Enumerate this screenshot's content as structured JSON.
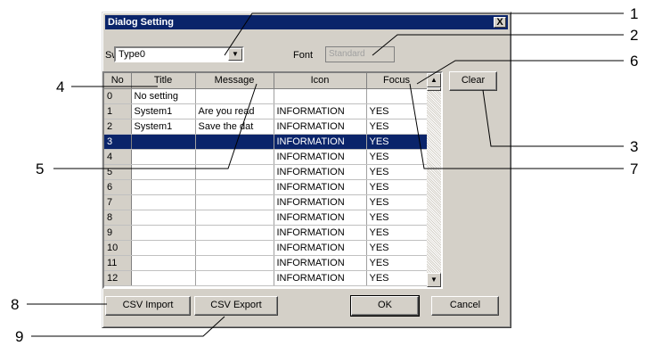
{
  "dialog": {
    "title": "Dialog Setting",
    "close_label": "X",
    "switch_label": "Switch",
    "switch_value": "Type0",
    "font_label": "Font",
    "font_value": "Standard"
  },
  "table": {
    "headers": [
      "No",
      "Title",
      "Message",
      "Icon",
      "Focus"
    ],
    "rows": [
      [
        "0",
        "No setting",
        "",
        "",
        ""
      ],
      [
        "1",
        "System1",
        "Are you read",
        "INFORMATION",
        "YES"
      ],
      [
        "2",
        "System1",
        "Save the dat",
        "INFORMATION",
        "YES"
      ],
      [
        "3",
        "",
        "",
        "INFORMATION",
        "YES"
      ],
      [
        "4",
        "",
        "",
        "INFORMATION",
        "YES"
      ],
      [
        "5",
        "",
        "",
        "INFORMATION",
        "YES"
      ],
      [
        "6",
        "",
        "",
        "INFORMATION",
        "YES"
      ],
      [
        "7",
        "",
        "",
        "INFORMATION",
        "YES"
      ],
      [
        "8",
        "",
        "",
        "INFORMATION",
        "YES"
      ],
      [
        "9",
        "",
        "",
        "INFORMATION",
        "YES"
      ],
      [
        "10",
        "",
        "",
        "INFORMATION",
        "YES"
      ],
      [
        "11",
        "",
        "",
        "INFORMATION",
        "YES"
      ],
      [
        "12",
        "",
        "",
        "INFORMATION",
        "YES"
      ]
    ],
    "selected_row": "3"
  },
  "buttons": {
    "clear": "Clear",
    "csv_import": "CSV Import",
    "csv_export": "CSV Export",
    "ok": "OK",
    "cancel": "Cancel"
  },
  "callouts": [
    "1",
    "2",
    "3",
    "4",
    "5",
    "6",
    "7",
    "8",
    "9"
  ],
  "colors": {
    "selection": "#0a246a",
    "face": "#d4d0c8"
  }
}
